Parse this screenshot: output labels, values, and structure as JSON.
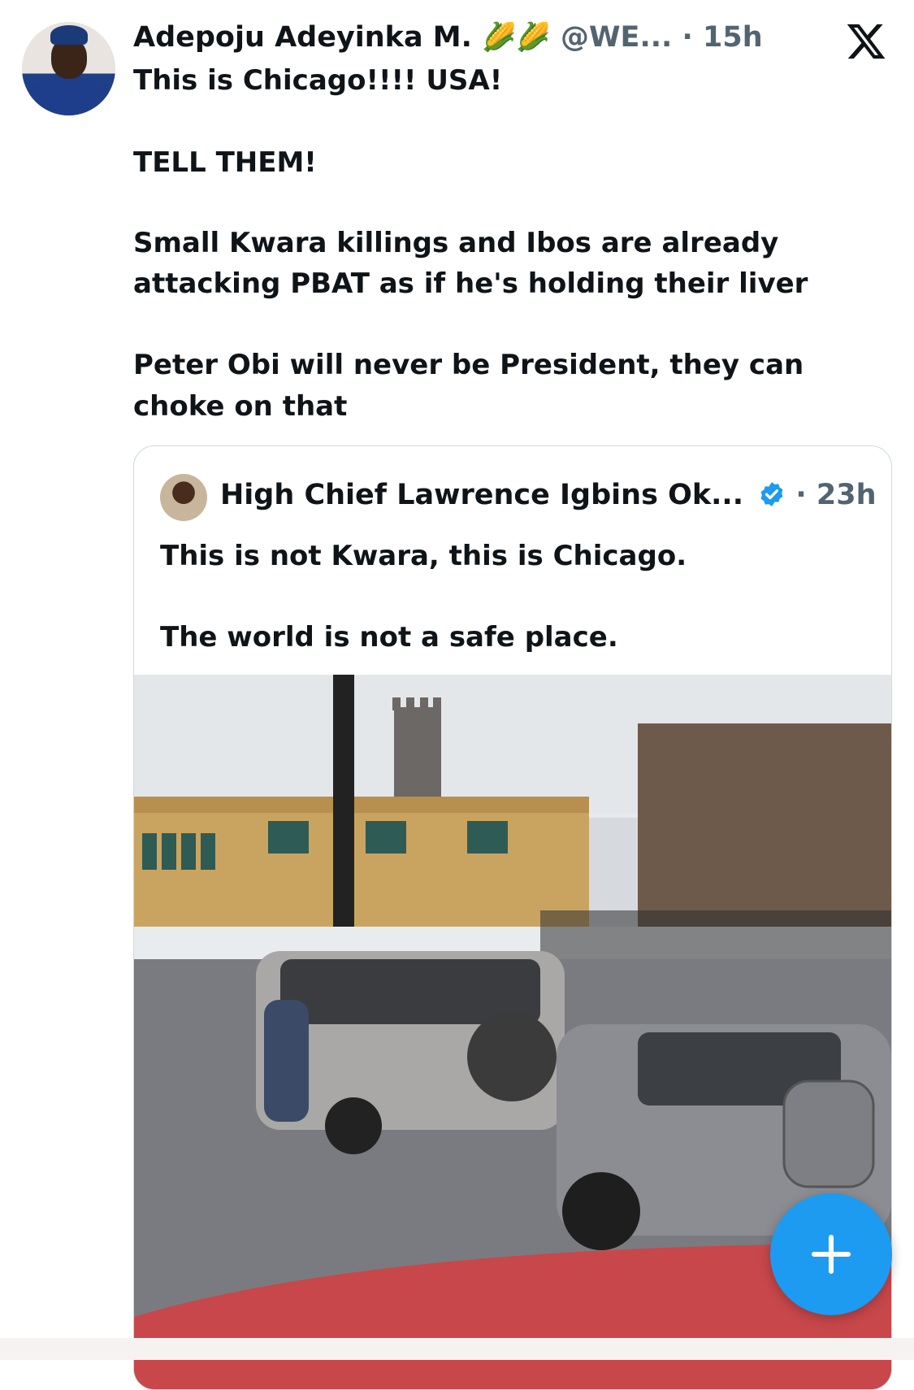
{
  "tweet": {
    "author_name": "Adepoju Adeyinka M.",
    "author_emoji": "🌽🌽",
    "handle": "@WE...",
    "time": "· 15h",
    "lines": [
      "This is Chicago!!!! USA!",
      "TELL THEM!",
      "Small Kwara killings and Ibos are already",
      "attacking PBAT as if he's holding their liver",
      "Peter Obi will never be President, they can",
      "choke on that"
    ]
  },
  "quoted": {
    "author_name": "High Chief Lawrence Igbins Ok...",
    "time": "· 23h",
    "lines": [
      "This is not Kwara, this is Chicago.",
      "The world is not a safe place."
    ]
  },
  "icons": {
    "platform": "x-logo-icon",
    "verified": "verified-badge-icon",
    "compose": "plus-icon"
  },
  "colors": {
    "accent": "#1d9bf0",
    "text": "#0f1419",
    "muted": "#536471"
  }
}
